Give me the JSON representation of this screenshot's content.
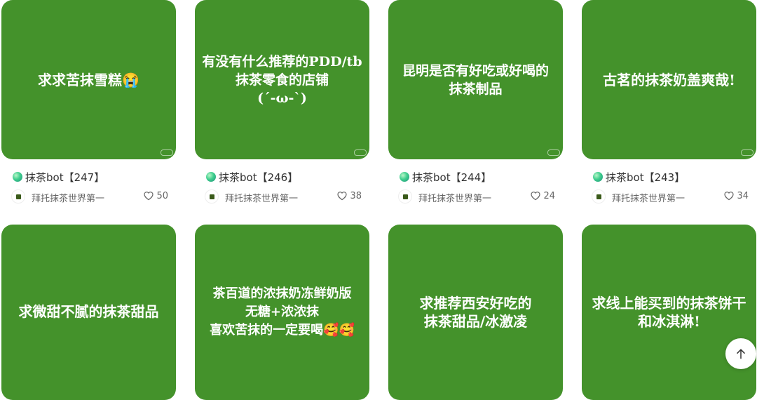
{
  "feed": {
    "row1": [
      {
        "cover_text": "求求苦抹雪糕😭",
        "title": "抹茶bot【247】",
        "author": "拜托抹茶世界第一",
        "likes": "50"
      },
      {
        "cover_text": "有没有什么推荐的PDD/tb\n抹茶零食的店铺\n(´-ω-`)",
        "title": "抹茶bot【246】",
        "author": "拜托抹茶世界第一",
        "likes": "38"
      },
      {
        "cover_text": "昆明是否有好吃或好喝的\n抹茶制品",
        "title": "抹茶bot【244】",
        "author": "拜托抹茶世界第一",
        "likes": "24"
      },
      {
        "cover_text": "古茗的抹茶奶盖爽哉!",
        "title": "抹茶bot【243】",
        "author": "拜托抹茶世界第一",
        "likes": "34"
      }
    ],
    "row2": [
      {
        "cover_text": "求微甜不腻的抹茶甜品"
      },
      {
        "cover_text": "茶百道的浓抹奶冻鲜奶版\n无糖+浓浓抹\n喜欢苦抹的一定要喝🥰🥰"
      },
      {
        "cover_text": "求推荐西安好吃的\n抹茶甜品/冰激凌"
      },
      {
        "cover_text": "求线上能买到的抹茶饼干\n和冰淇淋!"
      }
    ]
  },
  "icons": {
    "like": "heart-icon",
    "scroll_top": "arrow-up-icon",
    "title_badge": "green-orb-icon"
  },
  "colors": {
    "cover": "#44922b",
    "text_primary": "#333333",
    "text_secondary": "#666666"
  }
}
